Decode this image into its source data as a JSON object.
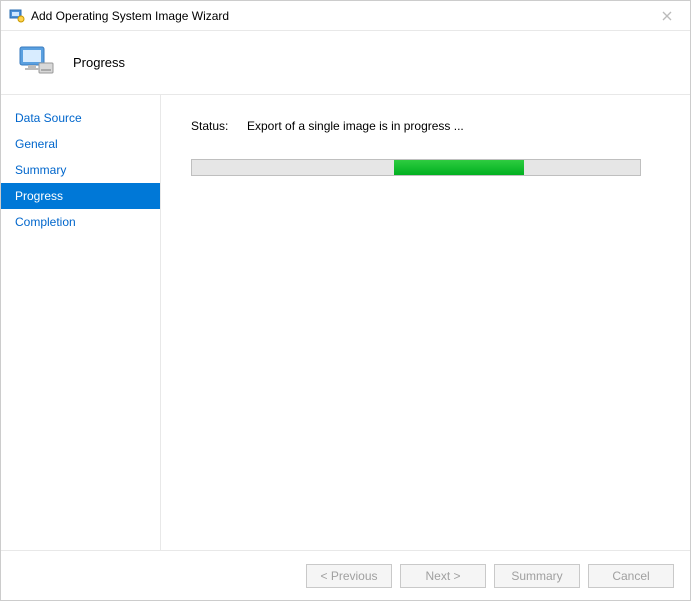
{
  "titlebar": {
    "title": "Add Operating System Image Wizard"
  },
  "header": {
    "title": "Progress"
  },
  "sidebar": {
    "items": [
      {
        "label": "Data Source",
        "active": false
      },
      {
        "label": "General",
        "active": false
      },
      {
        "label": "Summary",
        "active": false
      },
      {
        "label": "Progress",
        "active": true
      },
      {
        "label": "Completion",
        "active": false
      }
    ]
  },
  "content": {
    "status_label": "Status:",
    "status_text": "Export of a single image is in progress ...",
    "progress": {
      "indeterminate": true,
      "block_left_percent": 45,
      "block_width_percent": 29
    }
  },
  "footer": {
    "previous": "< Previous",
    "next": "Next >",
    "summary": "Summary",
    "cancel": "Cancel"
  }
}
